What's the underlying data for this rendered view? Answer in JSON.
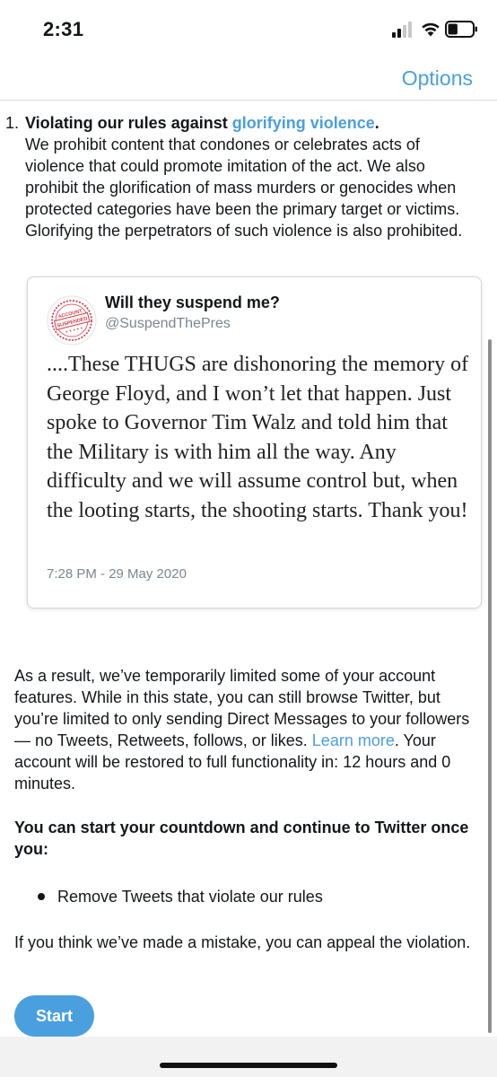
{
  "status_bar": {
    "time": "2:31",
    "signal_icon": "cellular-signal-icon",
    "wifi_icon": "wifi-icon",
    "battery_icon": "battery-icon",
    "battery_level": 0.4
  },
  "nav": {
    "options_label": "Options"
  },
  "rule": {
    "number": "1.",
    "title_prefix": "Violating our rules against ",
    "title_link": "glorifying violence",
    "title_suffix": ".",
    "description": "We prohibit content that condones or celebrates acts of violence that could promote imitation of the act. We also prohibit the glorification of mass murders or genocides when protected categories have been the primary target or victims. Glorifying the perpetrators of such violence is also prohibited."
  },
  "tweet": {
    "avatar_text_1": "ACCOUNT",
    "avatar_text_2": "SUSPENDED",
    "display_name": "Will they suspend me?",
    "handle": "@SuspendThePres",
    "text": "....These THUGS are dishonoring the memory of George Floyd, and I won’t let that happen. Just spoke to Governor Tim Walz and told him that the Military is with him all the way. Any difficulty and we will assume control but, when the looting starts, the shooting starts. Thank you!",
    "timestamp": "7:28 PM - 29 May 2020"
  },
  "result": {
    "text_before_link": "As a result, we’ve temporarily limited some of your account features. While in this state, you can still browse Twitter, but you’re limited to only sending Direct Messages to your followers — no Tweets, Retweets, follows, or likes. ",
    "link": "Learn more",
    "text_after_link": ". Your account will be restored to full functionality in: 12 hours and 0 minutes."
  },
  "countdown": {
    "heading": "You can start your countdown and continue to Twitter once you:",
    "items": [
      "Remove Tweets that violate our rules"
    ]
  },
  "appeal": {
    "text": "If you think we’ve made a mistake, you can appeal the violation."
  },
  "start_button": {
    "label": "Start"
  },
  "colors": {
    "accent": "#4a9fdf",
    "text": "#14171a",
    "secondary_text": "#7b868f",
    "stamp_red": "#d23b48"
  }
}
